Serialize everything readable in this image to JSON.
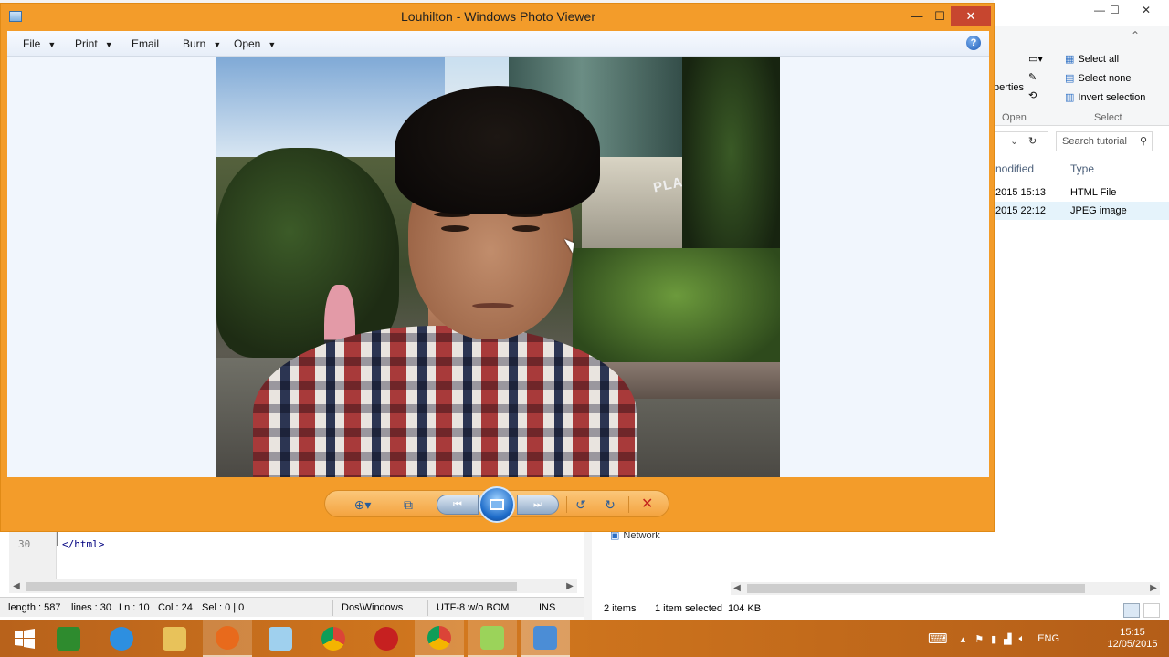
{
  "photo_viewer": {
    "title": "Louhilton - Windows Photo Viewer",
    "window_buttons": {
      "minimize": "—",
      "maximize": "☐",
      "close": "✕"
    },
    "menu": [
      {
        "label": "File",
        "has_caret": true
      },
      {
        "label": "Print",
        "has_caret": true
      },
      {
        "label": "Email",
        "has_caret": false
      },
      {
        "label": "Burn",
        "has_caret": true
      },
      {
        "label": "Open",
        "has_caret": true
      }
    ],
    "help_label": "?",
    "photo_sign_text": "PLAZA",
    "controls": {
      "zoom": "⊕▾",
      "fit": "⧉",
      "prev": "⏮",
      "next": "⏭",
      "rotate_ccw": "↺",
      "rotate_cw": "↻",
      "delete": "✕"
    },
    "frame_color": "#f39c2a"
  },
  "notepadpp": {
    "line_number": "30",
    "code_line": "</html>",
    "status": {
      "length": "length : 587",
      "lines": "lines : 30",
      "ln": "Ln : 10",
      "col": "Col : 24",
      "sel": "Sel : 0 | 0",
      "eol": "Dos\\Windows",
      "encoding": "UTF-8 w/o BOM",
      "mode": "INS"
    }
  },
  "explorer": {
    "window_buttons": {
      "minimize": "—",
      "maximize": "☐",
      "close": "✕"
    },
    "ribbon": {
      "properties_label": "perties",
      "select_all": "Select all",
      "select_none": "Select none",
      "invert_selection": "Invert selection",
      "group_open": "Open",
      "group_select": "Select"
    },
    "search_placeholder": "Search tutorial",
    "columns": {
      "modified": "nodified",
      "type": "Type"
    },
    "rows": [
      {
        "modified": "2015 15:13",
        "type": "HTML File"
      },
      {
        "modified": "2015 22:12",
        "type": "JPEG image"
      }
    ],
    "network_label": "Network",
    "status": {
      "items": "2 items",
      "selected": "1 item selected",
      "size": "104 KB"
    }
  },
  "taskbar": {
    "apps": [
      {
        "name": "start",
        "color": "#ffffff"
      },
      {
        "name": "store",
        "color": "#2e8b2e"
      },
      {
        "name": "internet-explorer",
        "color": "#2d8fe0"
      },
      {
        "name": "file-explorer",
        "color": "#e8c25a"
      },
      {
        "name": "firefox",
        "color": "#e86a1c"
      },
      {
        "name": "notepad",
        "color": "#9fd0ee"
      },
      {
        "name": "chrome",
        "color": "#3aa757"
      },
      {
        "name": "download-manager",
        "color": "#c62020"
      },
      {
        "name": "chrome-2",
        "color": "#3aa757"
      },
      {
        "name": "notepadpp",
        "color": "#9bd35a"
      },
      {
        "name": "photo-viewer",
        "color": "#4b8dd6"
      }
    ],
    "language": "ENG",
    "time": "15:15",
    "date": "12/05/2015"
  }
}
